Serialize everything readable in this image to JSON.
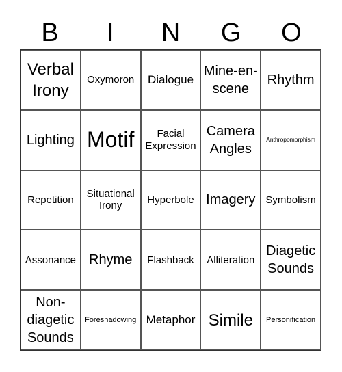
{
  "header": {
    "letters": [
      "B",
      "I",
      "N",
      "G",
      "O"
    ]
  },
  "cells": [
    "Verbal Irony",
    "Oxymoron",
    "Dialogue",
    "Mine-en-scene",
    "Rhythm",
    "Lighting",
    "Motif",
    "Facial Expression",
    "Camera Angles",
    "Anthropomorphism",
    "Repetition",
    "Situational Irony",
    "Hyperbole",
    "Imagery",
    "Symbolism",
    "Assonance",
    "Rhyme",
    "Flashback",
    "Alliteration",
    "Diagetic Sounds",
    "Non-diagetic Sounds",
    "Foreshadowing",
    "Metaphor",
    "Simile",
    "Personification"
  ]
}
